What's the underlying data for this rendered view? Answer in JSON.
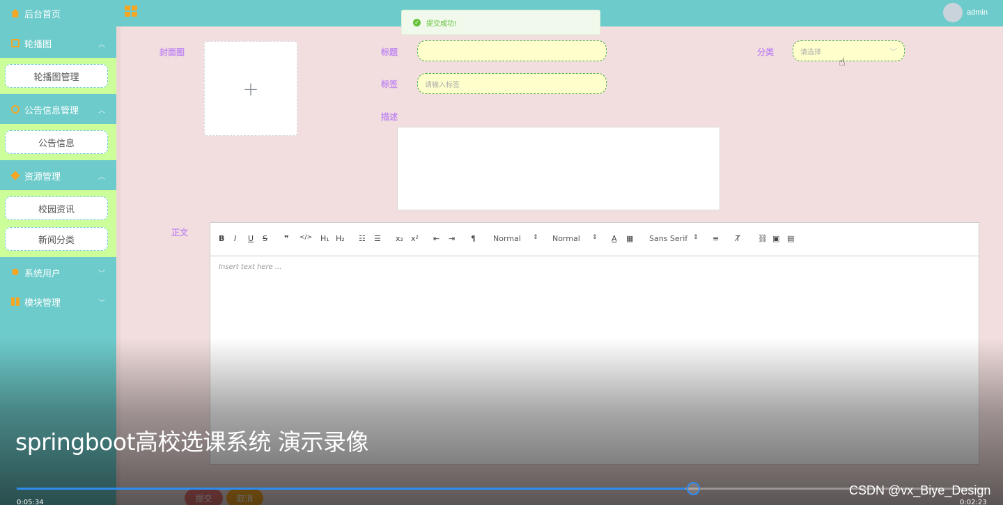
{
  "header": {
    "username": "admin"
  },
  "sidebar": {
    "home": "后台首页",
    "carousel": {
      "label": "轮播图",
      "items": [
        "轮播图管理"
      ]
    },
    "notice": {
      "label": "公告信息管理",
      "items": [
        "公告信息"
      ]
    },
    "resource": {
      "label": "资源管理",
      "items": [
        "校园资讯",
        "新闻分类"
      ]
    },
    "users": "系统用户",
    "modules": "模块管理"
  },
  "form": {
    "cover_label": "封面图",
    "title_label": "标题",
    "tags_label": "标签",
    "tags_placeholder": "请输入标签",
    "category_label": "分类",
    "category_placeholder": "请选择",
    "desc_label": "描述",
    "body_label": "正文",
    "editor_placeholder": "Insert text here ...",
    "submit": "提交",
    "cancel": "取消"
  },
  "editor_toolbar": {
    "header_select": "Normal",
    "size_select": "Normal",
    "font_select": "Sans Serif"
  },
  "toast": {
    "message": "提交成功!"
  },
  "video": {
    "title": "springboot高校选课系统 演示录像",
    "elapsed": "0:05:34",
    "duration": "0:02:23",
    "progress_fraction": 0.69,
    "watermark": "CSDN @vx_Biye_Design"
  },
  "colors": {
    "primary": "#6ecbcb",
    "submenu": "#ccff99",
    "accent": "#f5a623",
    "label": "#c38ef0"
  }
}
